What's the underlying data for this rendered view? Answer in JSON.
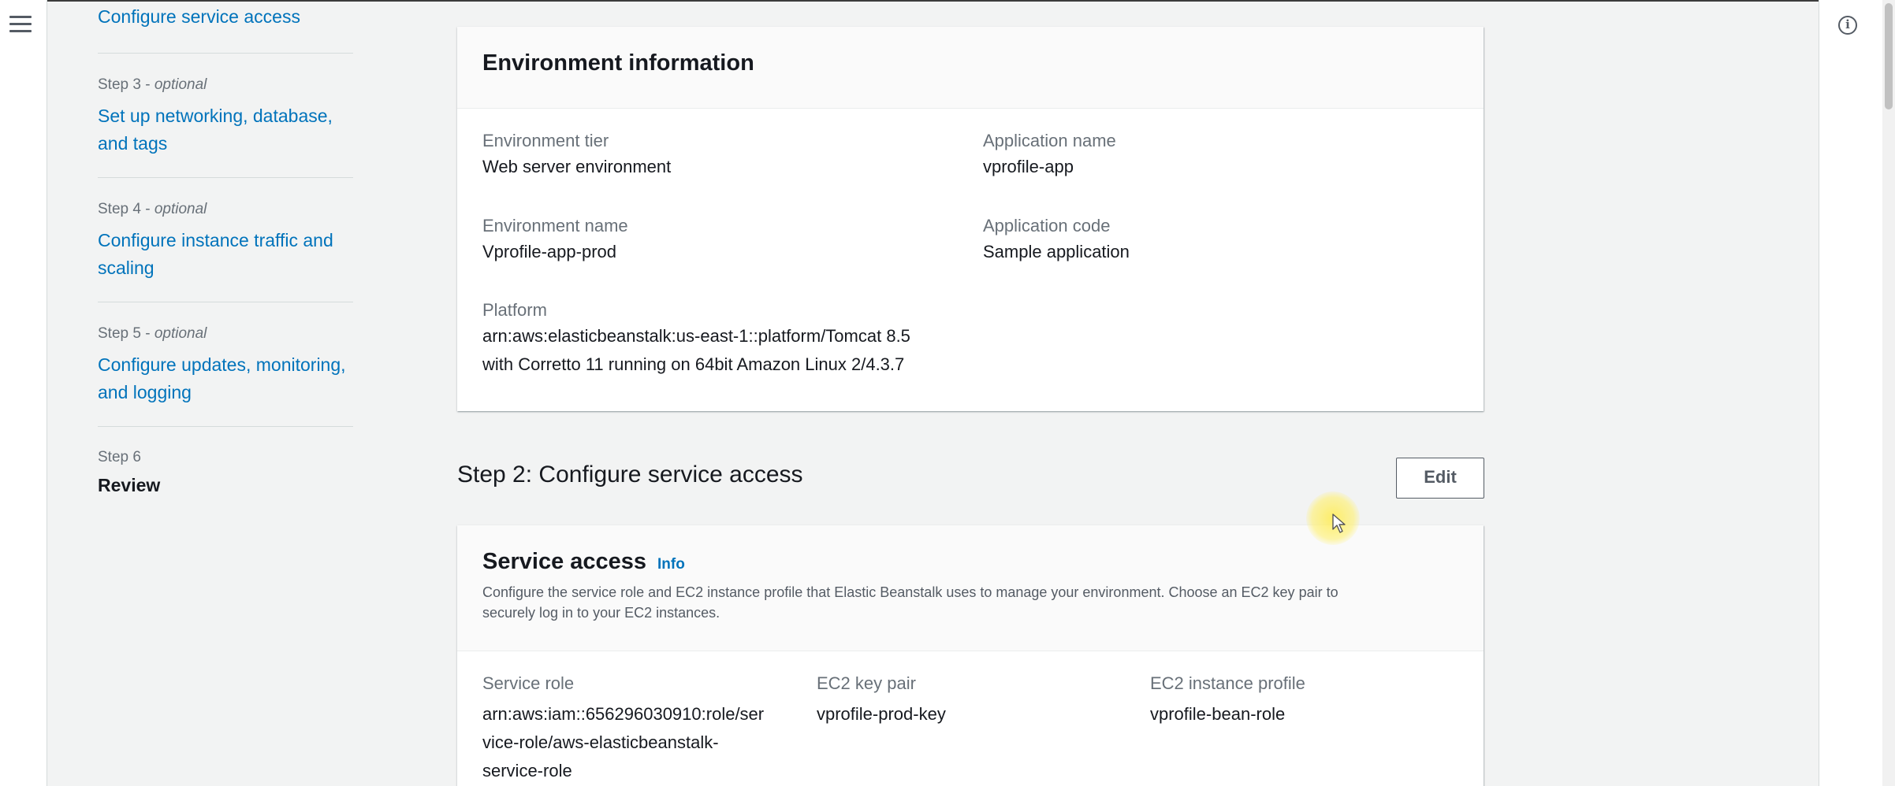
{
  "side_nav": {
    "step2_link": "Configure service access",
    "steps": [
      {
        "label": "Step 3",
        "optional": "optional",
        "title": "Set up networking, database, and tags"
      },
      {
        "label": "Step 4",
        "optional": "optional",
        "title": "Configure instance traffic and scaling"
      },
      {
        "label": "Step 5",
        "optional": "optional",
        "title": "Configure updates, monitoring, and logging"
      }
    ],
    "step6": {
      "label": "Step 6",
      "title": "Review"
    }
  },
  "env_info": {
    "title": "Environment information",
    "fields": {
      "environment_tier": {
        "label": "Environment tier",
        "value": "Web server environment"
      },
      "application_name": {
        "label": "Application name",
        "value": "vprofile-app"
      },
      "environment_name": {
        "label": "Environment name",
        "value": "Vprofile-app-prod"
      },
      "application_code": {
        "label": "Application code",
        "value": "Sample application"
      },
      "platform": {
        "label": "Platform",
        "value_line1": "arn:aws:elasticbeanstalk:us-east-1::platform/Tomcat 8.5",
        "value_line2": "with Corretto 11 running on 64bit Amazon Linux 2/4.3.7"
      }
    }
  },
  "step2": {
    "heading": "Step 2: Configure service access",
    "edit_label": "Edit"
  },
  "service_access": {
    "title": "Service access",
    "info_label": "Info",
    "description_line1": "Configure the service role and EC2 instance profile that Elastic Beanstalk uses to manage your environment. Choose an EC2 key pair to",
    "description_line2": "securely log in to your EC2 instances.",
    "fields": {
      "service_role": {
        "label": "Service role",
        "value_line1": "arn:aws:iam::656296030910:role/ser",
        "value_line2": "vice-role/aws-elasticbeanstalk-",
        "value_line3": "service-role"
      },
      "ec2_key_pair": {
        "label": "EC2 key pair",
        "value": "vprofile-prod-key"
      },
      "ec2_instance_profile": {
        "label": "EC2 instance profile",
        "value": "vprofile-bean-role"
      }
    }
  },
  "icons": {
    "menu": "hamburger-menu-icon",
    "info": "info-circle-icon",
    "cursor": "mouse-cursor-icon"
  },
  "colors": {
    "link": "#0073bb",
    "background": "#f2f3f3",
    "card": "#ffffff",
    "cursor_highlight": "#ffec50"
  }
}
